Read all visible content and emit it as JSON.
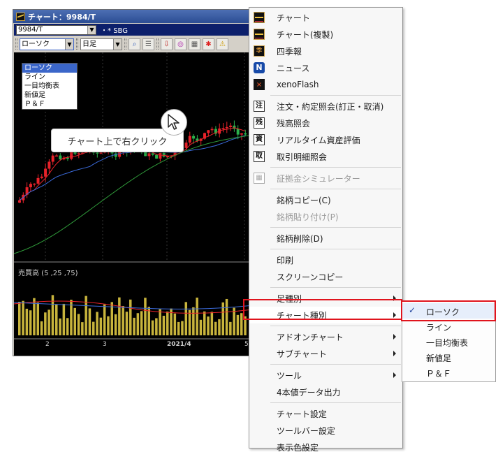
{
  "chart_window": {
    "title": "チャート：9984/T",
    "symbol_value": "9984/T",
    "symbol_name": "SBG",
    "chart_type_value": "ローソク",
    "period_value": "日足",
    "chart_types": [
      "ローソク",
      "ライン",
      "一目均衡表",
      "新値足",
      "Ｐ＆Ｆ"
    ],
    "subchart_label": "売買高 (5 ,25 ,75)",
    "x_axis_labels": [
      "2",
      "3",
      "2021/4",
      "5"
    ],
    "colors": {
      "up": "#e8222a",
      "down": "#2bb24c",
      "ma_short": "#e8222a",
      "ma_mid": "#3b6bdc",
      "ma_long": "#2f9a3a",
      "volume": "#c8b43c"
    }
  },
  "callout": {
    "text": "チャート上で右クリック"
  },
  "context_menu": {
    "items": [
      {
        "label": "チャート",
        "icon": "chart-icon"
      },
      {
        "label": "チャート(複製)",
        "icon": "chart-copy-icon"
      },
      {
        "label": "四季報",
        "icon": "shikiho-icon"
      },
      {
        "label": "ニュース",
        "icon": "news-icon"
      },
      {
        "label": "xenoFlash",
        "icon": "xenoflash-icon"
      },
      {
        "label": "注文・約定照会(訂正・取消)",
        "icon": "order-icon",
        "icon_text": "注"
      },
      {
        "label": "残高照会",
        "icon": "balance-icon",
        "icon_text": "残"
      },
      {
        "label": "リアルタイム資産評価",
        "icon": "asset-icon",
        "icon_text": "資"
      },
      {
        "label": "取引明細照会",
        "icon": "trade-detail-icon",
        "icon_text": "取"
      },
      {
        "label": "証拠金シミュレーター",
        "icon": "simulator-icon",
        "disabled": true
      },
      {
        "label": "銘柄コピー(C)"
      },
      {
        "label": "銘柄貼り付け(P)",
        "disabled": true
      },
      {
        "label": "銘柄削除(D)"
      },
      {
        "label": "印刷"
      },
      {
        "label": "スクリーンコピー"
      },
      {
        "label": "足種別",
        "submenu": true
      },
      {
        "label": "チャート種別",
        "submenu": true,
        "highlighted": true
      },
      {
        "label": "アドオンチャート",
        "submenu": true
      },
      {
        "label": "サブチャート",
        "submenu": true
      },
      {
        "label": "ツール",
        "submenu": true
      },
      {
        "label": "4本値データ出力"
      },
      {
        "label": "チャート設定"
      },
      {
        "label": "ツールバー設定"
      },
      {
        "label": "表示色設定"
      }
    ]
  },
  "submenu": {
    "items": [
      {
        "label": "ローソク",
        "checked": true
      },
      {
        "label": "ライン"
      },
      {
        "label": "一目均衡表"
      },
      {
        "label": "新値足"
      },
      {
        "label": "Ｐ＆Ｆ"
      }
    ]
  }
}
